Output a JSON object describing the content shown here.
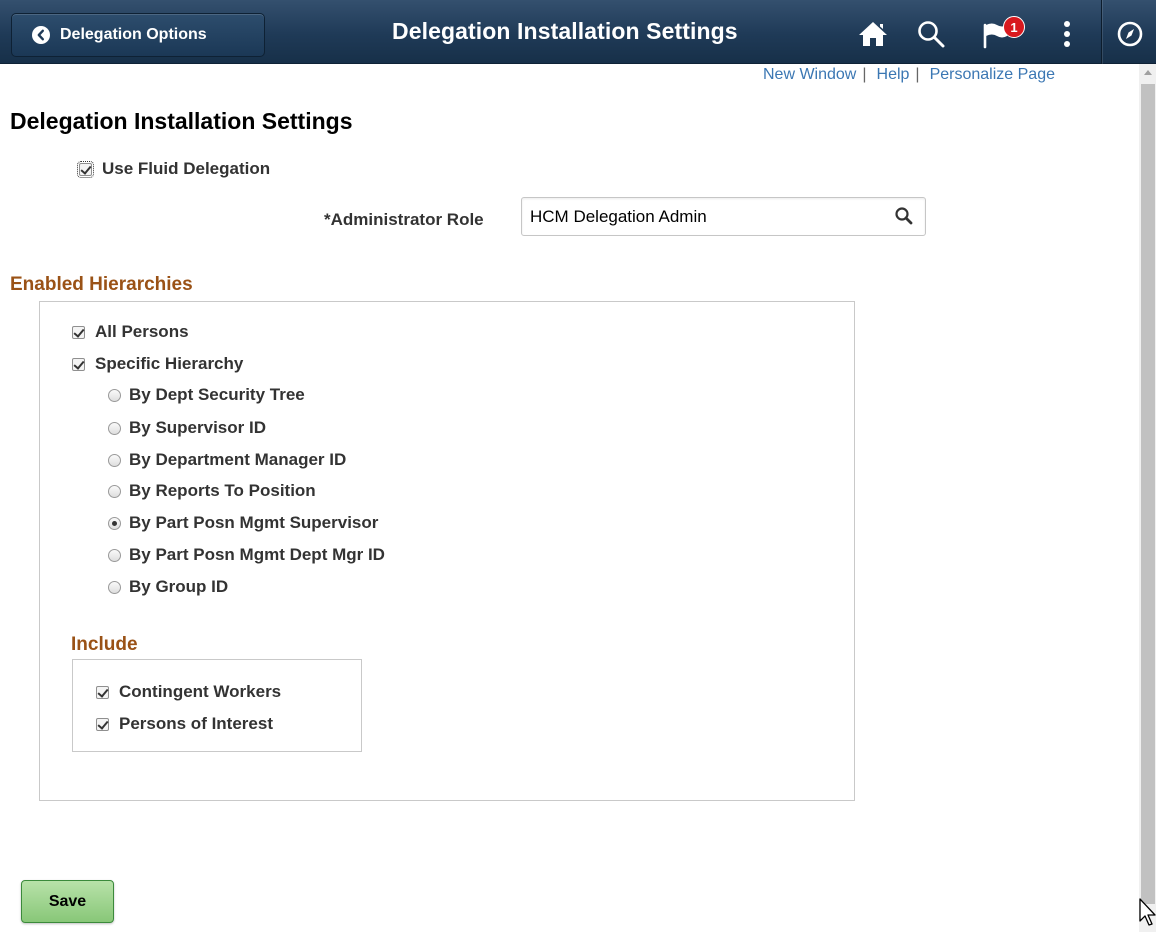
{
  "header": {
    "back_label": "Delegation Options",
    "title": "Delegation Installation Settings",
    "notification_count": "1",
    "colors": {
      "bar": "#1f3a57",
      "badge": "#d8191f"
    }
  },
  "links": {
    "new_window": "New Window",
    "help": "Help",
    "personalize": "Personalize Page"
  },
  "page": {
    "title": "Delegation Installation Settings"
  },
  "fluid": {
    "label": "Use Fluid Delegation",
    "checked": true
  },
  "admin_role": {
    "label": "*Administrator Role",
    "value": "HCM Delegation Admin"
  },
  "hierarchies": {
    "heading": "Enabled Hierarchies",
    "all_persons": "All Persons",
    "specific": "Specific Hierarchy",
    "options": [
      "By Dept Security Tree",
      "By Supervisor ID",
      "By Department Manager ID",
      "By Reports To Position",
      "By Part Posn Mgmt Supervisor",
      "By Part Posn Mgmt Dept Mgr ID",
      "By Group ID"
    ],
    "selected_option": "By Part Posn Mgmt Supervisor"
  },
  "include": {
    "heading": "Include",
    "contingent": "Contingent Workers",
    "persons_of_interest": "Persons of Interest"
  },
  "actions": {
    "save": "Save"
  }
}
